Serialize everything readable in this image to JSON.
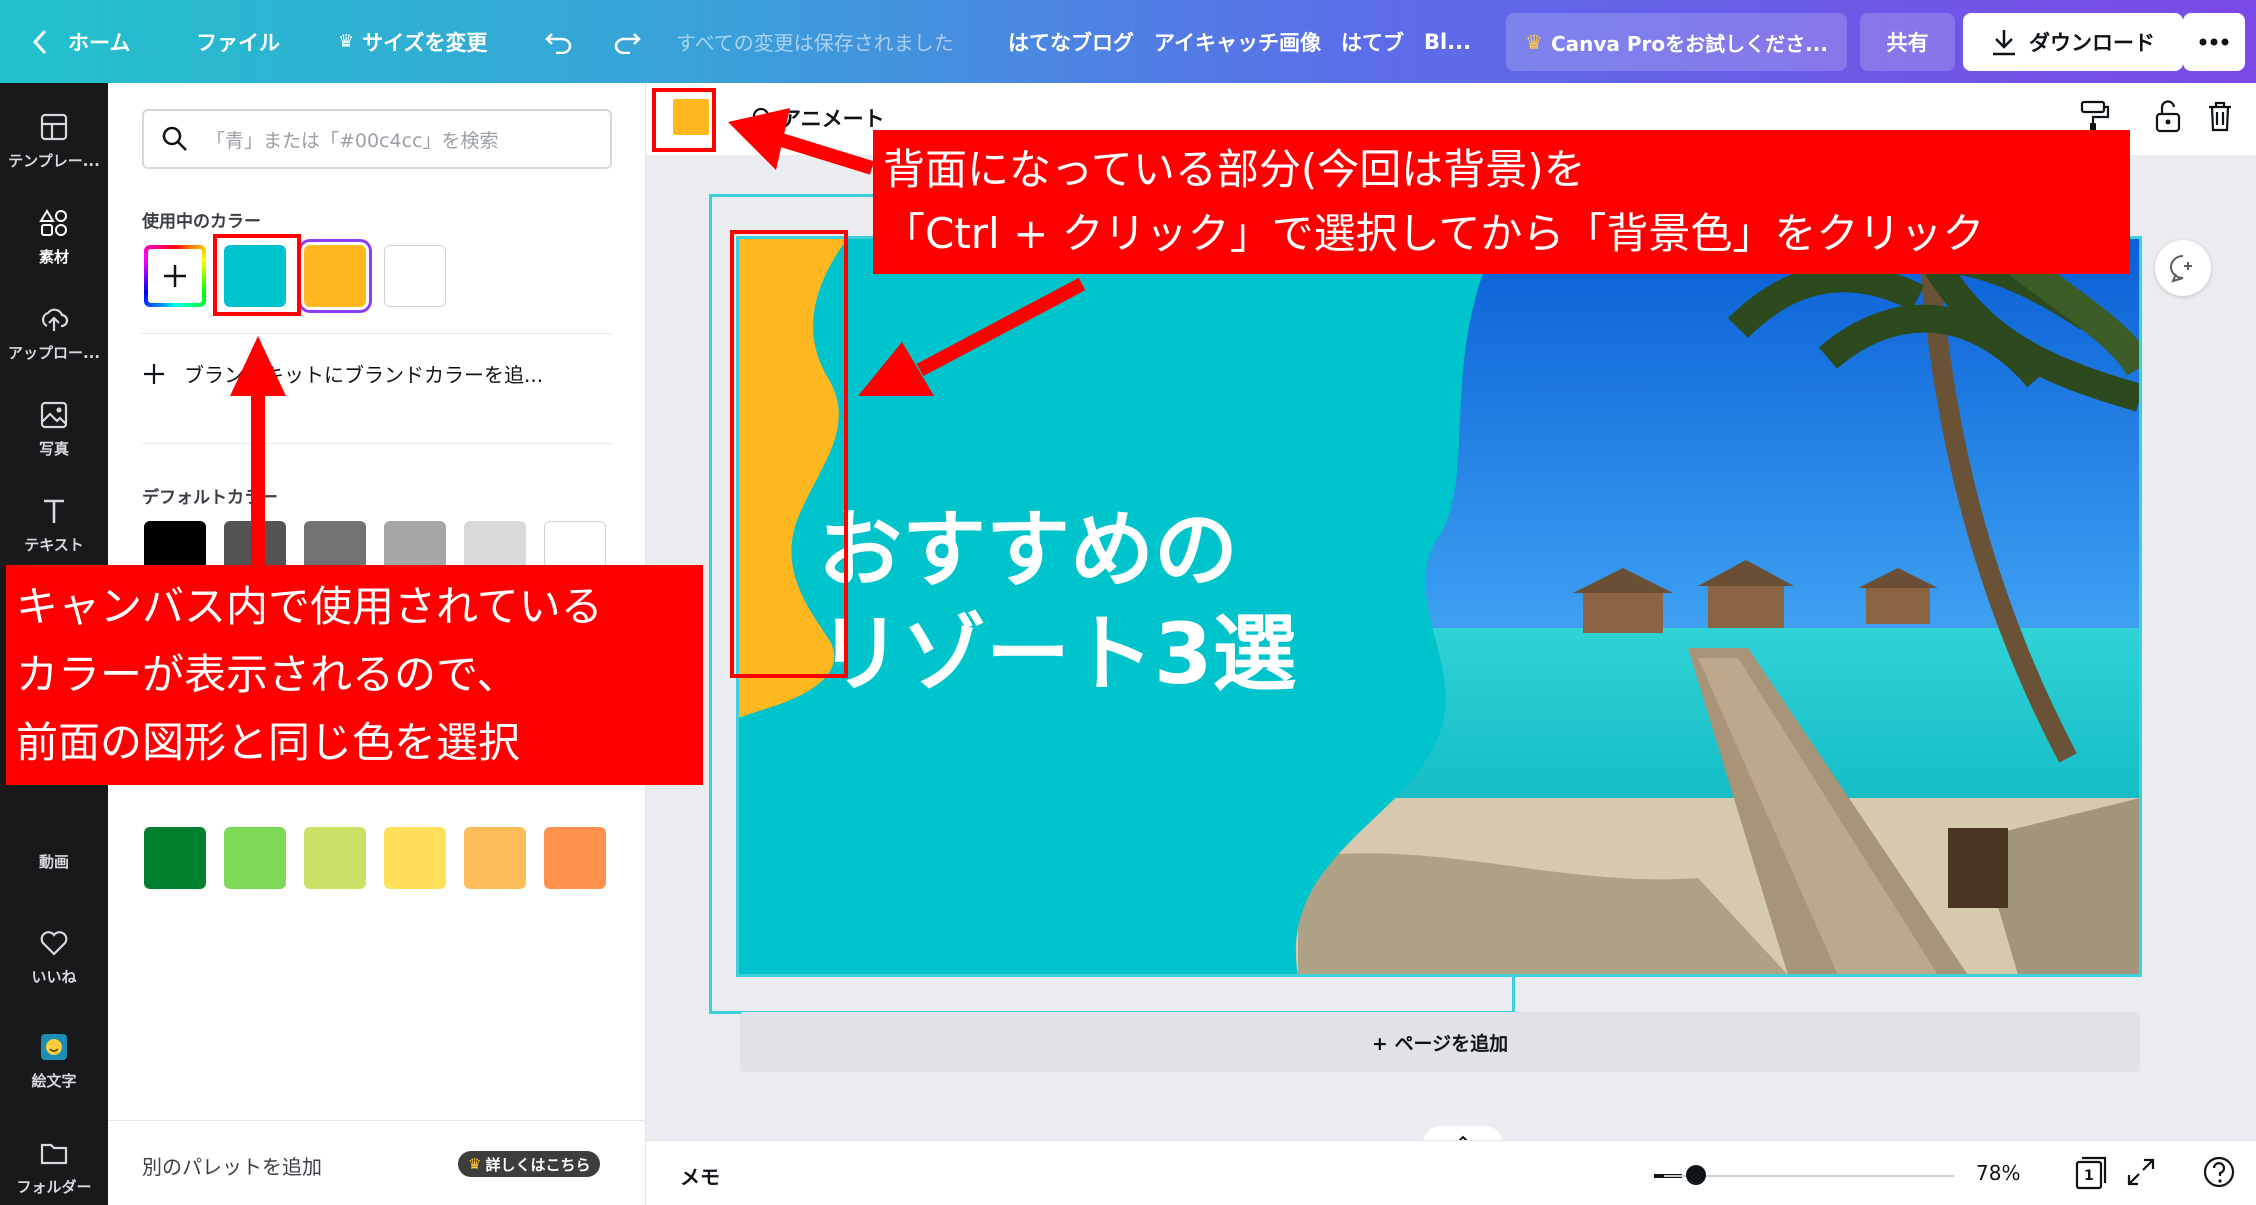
{
  "topbar": {
    "back_label": "ホーム",
    "file_label": "ファイル",
    "resize_label": "サイズを変更",
    "save_status": "すべての変更は保存されました",
    "title_parts": [
      "はてなブログ",
      "アイキャッチ画像",
      "はてブ",
      "Bl..."
    ],
    "pro_label": "Canva Proをお試しくださ...",
    "share_label": "共有",
    "download_label": "ダウンロード"
  },
  "rail": {
    "items": [
      {
        "label": "テンプレー...",
        "icon": "template-icon"
      },
      {
        "label": "素材",
        "icon": "elements-icon"
      },
      {
        "label": "アップロー...",
        "icon": "upload-icon"
      },
      {
        "label": "写真",
        "icon": "photo-icon"
      },
      {
        "label": "テキスト",
        "icon": "text-icon"
      },
      {
        "label": "動画",
        "icon": "video-icon"
      },
      {
        "label": "いいね",
        "icon": "heart-icon"
      },
      {
        "label": "絵文字",
        "icon": "emoji-icon"
      },
      {
        "label": "フォルダー",
        "icon": "folder-icon"
      }
    ]
  },
  "panel": {
    "search_placeholder": "「青」または「#00c4cc」を検索",
    "in_use_label": "使用中のカラー",
    "in_use_colors": [
      "#00c4cc",
      "#ffb820",
      "#ffffff"
    ],
    "add_brand_label": "ブランドキットにブランドカラーを追...",
    "default_label": "デフォルトカラー",
    "default_row1": [
      "#000000",
      "#545454",
      "#737373",
      "#a6a6a6",
      "#d9d9d9",
      "#ffffff"
    ],
    "default_row_last": [
      "#00802f",
      "#7ed957",
      "#c9e265",
      "#ffde59",
      "#ffbd59",
      "#ff914d"
    ],
    "footer_label": "別のパレットを追加",
    "footer_badge": "詳しくはこちら"
  },
  "editor": {
    "animate_label": "アニメート",
    "headline_line1": "おすすめの",
    "headline_line2": "リゾート3選",
    "add_page_label": "+ ページを追加",
    "selected_color": "#ffb820"
  },
  "bottombar": {
    "memo_label": "メモ",
    "zoom_value": "78%",
    "zoom_level": 0.78,
    "page_count": "1"
  },
  "annotations": {
    "callout1_line1": "背面になっている部分(今回は背景)を",
    "callout1_line2": "「Ctrl + クリック」で選択してから「背景色」をクリック",
    "callout2_line1": "キャンバス内で使用されている",
    "callout2_line2": "カラーが表示されるので、",
    "callout2_line3": "前面の図形と同じ色を選択"
  },
  "colors": {
    "accent": "#00c4cc",
    "orange": "#ffb820",
    "annotation_red": "#ff0000"
  }
}
